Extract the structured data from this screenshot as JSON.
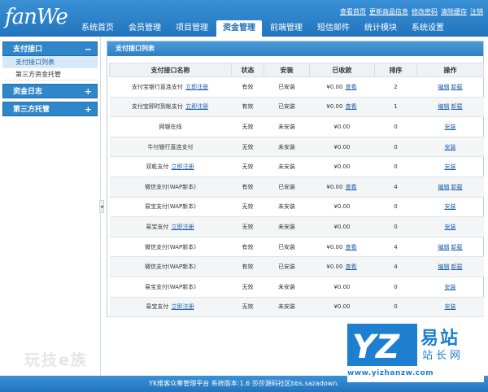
{
  "brand": {
    "logo_text": "fanWe"
  },
  "top_links": [
    "查看首页",
    "更新商品信息",
    "修改密码",
    "清除缓存",
    "注销"
  ],
  "nav": {
    "tabs": [
      "系统首页",
      "会员管理",
      "项目管理",
      "资金管理",
      "前端管理",
      "短信邮件",
      "统计模块",
      "系统设置"
    ],
    "active_index": 3
  },
  "sidebar": {
    "groups": [
      {
        "title": "支付接口",
        "sign": "−",
        "items": [
          "支付接口列表",
          "第三方资金托管"
        ],
        "active_item": 0
      },
      {
        "title": "资金日志",
        "sign": "+"
      },
      {
        "title": "第三方托管",
        "sign": "+"
      }
    ]
  },
  "panel": {
    "title": "支付接口列表"
  },
  "table": {
    "headers": [
      "支付接口名称",
      "状态",
      "安装",
      "已收款",
      "排序",
      "操作"
    ],
    "rows": [
      {
        "name": "支付宝银行直连支付",
        "reg": "立即注册",
        "status": "有效",
        "install": "已安装",
        "amount": "¥0.00",
        "view": "查看",
        "sort": "2",
        "edit": "编辑",
        "uninstall": "卸载",
        "installLink": ""
      },
      {
        "name": "支付宝即时到帐支付",
        "reg": "立即注册",
        "status": "有效",
        "install": "已安装",
        "amount": "¥0.00",
        "view": "查看",
        "sort": "1",
        "edit": "编辑",
        "uninstall": "卸载",
        "installLink": ""
      },
      {
        "name": "网银在线",
        "reg": "",
        "status": "无效",
        "install": "未安装",
        "amount": "¥0.00",
        "view": "",
        "sort": "0",
        "edit": "",
        "uninstall": "",
        "installLink": "安装"
      },
      {
        "name": "牛付银行直连支付",
        "reg": "",
        "status": "无效",
        "install": "未安装",
        "amount": "¥0.00",
        "view": "",
        "sort": "0",
        "edit": "",
        "uninstall": "",
        "installLink": "安装"
      },
      {
        "name": "双乾支付",
        "reg": "立即注册",
        "status": "无效",
        "install": "未安装",
        "amount": "¥0.00",
        "view": "",
        "sort": "0",
        "edit": "",
        "uninstall": "",
        "installLink": "安装"
      },
      {
        "name": "微信支付(WAP新本)",
        "reg": "",
        "status": "有效",
        "install": "已安装",
        "amount": "¥0.00",
        "view": "查看",
        "sort": "4",
        "edit": "编辑",
        "uninstall": "卸载",
        "installLink": ""
      },
      {
        "name": "易宝支付(WAP新本)",
        "reg": "",
        "status": "无效",
        "install": "未安装",
        "amount": "¥0.00",
        "view": "",
        "sort": "0",
        "edit": "",
        "uninstall": "",
        "installLink": "安装"
      },
      {
        "name": "易宝支付",
        "reg": "立即注册",
        "status": "无效",
        "install": "未安装",
        "amount": "¥0.00",
        "view": "",
        "sort": "0",
        "edit": "",
        "uninstall": "",
        "installLink": "安装"
      },
      {
        "name": "微信支付(WAP新本)",
        "reg": "",
        "status": "有效",
        "install": "已安装",
        "amount": "¥0.00",
        "view": "查看",
        "sort": "4",
        "edit": "编辑",
        "uninstall": "卸载",
        "installLink": ""
      },
      {
        "name": "微信支付(WAP新本)",
        "reg": "",
        "status": "有效",
        "install": "已安装",
        "amount": "¥0.00",
        "view": "查看",
        "sort": "4",
        "edit": "编辑",
        "uninstall": "卸载",
        "installLink": ""
      },
      {
        "name": "易宝支付(WAP新本)",
        "reg": "",
        "status": "无效",
        "install": "未安装",
        "amount": "¥0.00",
        "view": "",
        "sort": "0",
        "edit": "",
        "uninstall": "",
        "installLink": "安装"
      },
      {
        "name": "易宝支付",
        "reg": "立即注册",
        "status": "无效",
        "install": "未安装",
        "amount": "¥0.00",
        "view": "",
        "sort": "0",
        "edit": "",
        "uninstall": "",
        "installLink": "安装"
      }
    ]
  },
  "footer": {
    "text": "YK维客众筹管理平台 系统版本:1.6 莎莎源码社区bbs.sazadown."
  },
  "watermark": {
    "big": "易站",
    "sub": "站长网",
    "url": "www.yizhanzw.com",
    "left": "玩技e族"
  },
  "colors": {
    "header": "#2a7fc8",
    "link": "#1f5fae",
    "panel_head": "#3a8bd0"
  }
}
